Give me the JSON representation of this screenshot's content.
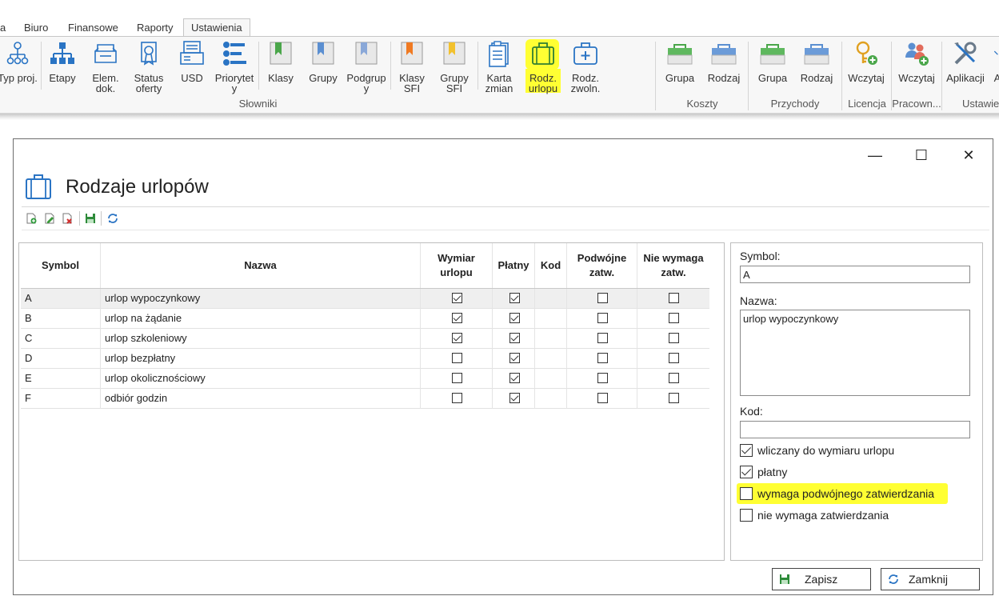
{
  "ribbon_tabs": [
    "a",
    "Biuro",
    "Finansowe",
    "Raporty",
    "Ustawienia"
  ],
  "ribbon_buttons": [
    {
      "label": "Typ proj.",
      "icon": "project-type-icon"
    },
    {
      "label": "Etapy",
      "icon": "stages-icon"
    },
    {
      "label": "Elem.\ndok.",
      "icon": "document-elements-icon"
    },
    {
      "label": "Status\noferty",
      "icon": "offer-status-icon"
    },
    {
      "label": "USD",
      "icon": "usd-icon"
    },
    {
      "label": "Priorytet\ny",
      "icon": "priorities-icon"
    },
    {
      "label": "Klasy",
      "icon": "classes-icon"
    },
    {
      "label": "Grupy",
      "icon": "groups-icon"
    },
    {
      "label": "Podgrup\ny",
      "icon": "subgroups-icon"
    },
    {
      "label": "Klasy\nSFI",
      "icon": "sfi-classes-icon"
    },
    {
      "label": "Grupy\nSFI",
      "icon": "sfi-groups-icon"
    },
    {
      "label": "Karta\nzmian",
      "icon": "shift-card-icon"
    },
    {
      "label": "Rodz.\nurlopu",
      "icon": "leave-types-icon"
    },
    {
      "label": "Rodz.\nzwoln.",
      "icon": "sick-leave-types-icon"
    },
    {
      "label": "Grupa",
      "icon": "cost-group-icon"
    },
    {
      "label": "Rodzaj",
      "icon": "cost-type-icon"
    },
    {
      "label": "Grupa",
      "icon": "income-group-icon"
    },
    {
      "label": "Rodzaj",
      "icon": "income-type-icon"
    },
    {
      "label": "Wczytaj",
      "icon": "license-load-icon"
    },
    {
      "label": "Wczytaj",
      "icon": "employees-load-icon"
    },
    {
      "label": "Aplikacji",
      "icon": "app-settings-icon"
    },
    {
      "label": "A",
      "icon": "more-icon"
    }
  ],
  "ribbon_groups": [
    "Słowniki",
    "Koszty",
    "Przychody",
    "Licencja",
    "Pracown...",
    "Ustawie"
  ],
  "window": {
    "minimize": "—",
    "maximize": "☐",
    "close": "✕",
    "title": "Rodzaje urlopów"
  },
  "grid": {
    "headers": {
      "symbol": "Symbol",
      "nazwa": "Nazwa",
      "wymiar": "Wymiar\nurlopu",
      "platny": "Płatny",
      "kod": "Kod",
      "podwojne": "Podwójne\nzatw.",
      "nie_wymaga": "Nie wymaga\nzatw."
    },
    "rows": [
      {
        "symbol": "A",
        "nazwa": "urlop wypoczynkowy",
        "wymiar": true,
        "platny": true,
        "kod": "",
        "podwojne": false,
        "nie_wymaga": false
      },
      {
        "symbol": "B",
        "nazwa": "urlop na żądanie",
        "wymiar": true,
        "platny": true,
        "kod": "",
        "podwojne": false,
        "nie_wymaga": false
      },
      {
        "symbol": "C",
        "nazwa": "urlop szkoleniowy",
        "wymiar": true,
        "platny": true,
        "kod": "",
        "podwojne": false,
        "nie_wymaga": false
      },
      {
        "symbol": "D",
        "nazwa": "urlop bezpłatny",
        "wymiar": false,
        "platny": true,
        "kod": "",
        "podwojne": false,
        "nie_wymaga": false
      },
      {
        "symbol": "E",
        "nazwa": "urlop okolicznościowy",
        "wymiar": false,
        "platny": true,
        "kod": "",
        "podwojne": false,
        "nie_wymaga": false
      },
      {
        "symbol": "F",
        "nazwa": "odbiór godzin",
        "wymiar": false,
        "platny": true,
        "kod": "",
        "podwojne": false,
        "nie_wymaga": false
      }
    ]
  },
  "detail": {
    "symbol_label": "Symbol:",
    "symbol_value": "A",
    "nazwa_label": "Nazwa:",
    "nazwa_value": "urlop wypoczynkowy",
    "kod_label": "Kod:",
    "kod_value": "",
    "checkboxes": [
      {
        "label": "wliczany do wymiaru urlopu",
        "checked": true
      },
      {
        "label": "płatny",
        "checked": true
      },
      {
        "label": "wymaga podwójnego zatwierdzania",
        "checked": false
      },
      {
        "label": "nie wymaga zatwierdzania",
        "checked": false
      }
    ]
  },
  "buttons": {
    "save": "Zapisz",
    "close": "Zamknij"
  },
  "colors": {
    "highlight": "#ffff33",
    "accent_blue": "#2a74c4",
    "save_green": "#2e8b3a"
  }
}
